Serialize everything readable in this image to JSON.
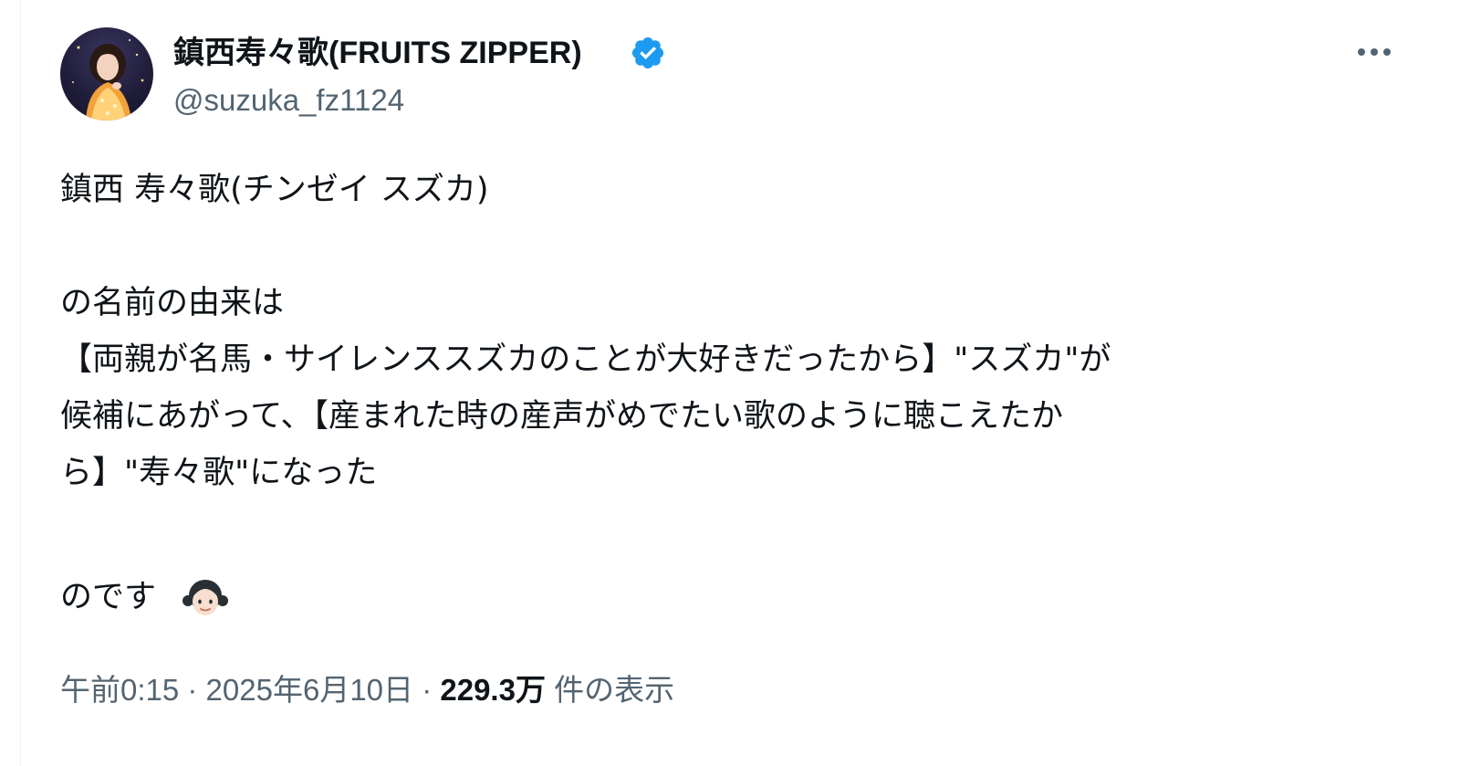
{
  "tweet": {
    "author": {
      "display_name": "鎮西寿々歌(FRUITS ZIPPER)",
      "handle": "@suzuka_fz1124",
      "verified": true,
      "verified_color": "#1d9bf0"
    },
    "more_icon": "more-horizontal-icon",
    "body_lines": [
      "鎮西 寿々歌(チンゼイ スズカ)",
      "",
      "の名前の由来は",
      "【両親が名馬・サイレンススズカのことが大好きだったから】\"スズカ\"が",
      "候補にあがって、【産まれた時の産声がめでたい歌のように聴こえたか",
      "ら】\"寿々歌\"になった",
      "",
      "のです"
    ],
    "trailing_emoji": "girl-emoji",
    "timestamp": "午前0:15 · 2025年6月10日",
    "separator": " · ",
    "views_count": "229.3万",
    "views_label": " 件の表示"
  },
  "colors": {
    "text_primary": "#0f1419",
    "text_secondary": "#536471",
    "accent": "#1d9bf0"
  }
}
